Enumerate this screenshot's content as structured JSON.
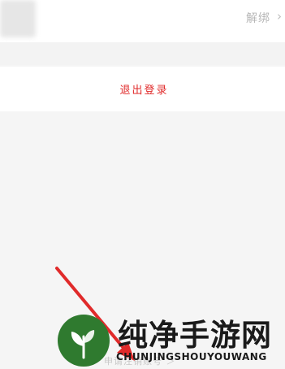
{
  "account": {
    "unbind_label": "解绑",
    "chevron": "›"
  },
  "logout": {
    "label": "退出登录"
  },
  "footer": {
    "apply_link": "申请注销账号 ＞"
  },
  "watermark": {
    "title": "纯净手游网",
    "subtitle": "CHUNJINGSHOUYOUWANG"
  },
  "colors": {
    "accent_red": "#e02a2a",
    "logo_green": "#2f7a2f",
    "page_bg": "#f5f5f5"
  },
  "icons": {
    "chevron": "chevron-right-icon",
    "annotation_arrow": "red-arrow-icon",
    "logo": "leaf-logo-icon"
  }
}
